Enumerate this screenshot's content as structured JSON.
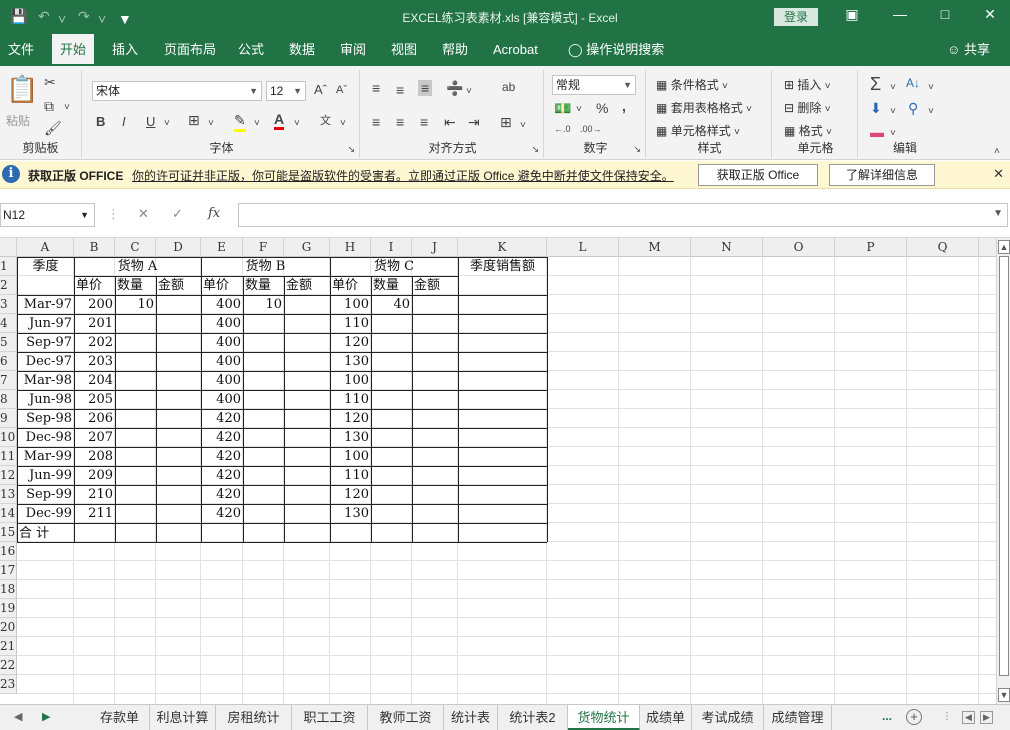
{
  "window": {
    "title": "EXCEL练习表素材.xls  [兼容模式]  -  Excel",
    "login_label": "登录"
  },
  "ribbon_tabs": [
    "文件",
    "开始",
    "插入",
    "页面布局",
    "公式",
    "数据",
    "审阅",
    "视图",
    "帮助",
    "Acrobat"
  ],
  "active_tab": "开始",
  "tell_me": "操作说明搜索",
  "share_label": "共享",
  "ribbon": {
    "clipboard": {
      "paste": "粘贴",
      "label": "剪贴板"
    },
    "font": {
      "name": "宋体",
      "size": "12",
      "label": "字体",
      "bold": "B",
      "italic": "I",
      "underline": "U"
    },
    "alignment": {
      "label": "对齐方式"
    },
    "number": {
      "format": "常规",
      "label": "数字"
    },
    "styles": {
      "conditional": "条件格式",
      "table": "套用表格格式",
      "cell_styles": "单元格样式",
      "label": "样式"
    },
    "cells": {
      "insert": "插入",
      "delete": "删除",
      "format": "格式",
      "label": "单元格"
    },
    "editing": {
      "label": "编辑"
    }
  },
  "infobar": {
    "title": "获取正版 OFFICE",
    "message": "你的许可证并非正版，你可能是盗版软件的受害者。立即通过正版 Office 避免中断并使文件保持安全。",
    "button_get": "获取正版 Office",
    "button_learn": "了解详细信息"
  },
  "formula_bar": {
    "name_box": "N12",
    "formula": ""
  },
  "columns": [
    "A",
    "B",
    "C",
    "D",
    "E",
    "F",
    "G",
    "H",
    "I",
    "J",
    "K",
    "L",
    "M",
    "N",
    "O",
    "P",
    "Q"
  ],
  "rows": [
    "1",
    "2",
    "3",
    "4",
    "5",
    "6",
    "7",
    "8",
    "9",
    "10",
    "11",
    "12",
    "13",
    "14",
    "15",
    "16",
    "17",
    "18",
    "19",
    "20",
    "21",
    "22",
    "23"
  ],
  "sheet": {
    "header1": {
      "season": "季度",
      "goods_a": "货物 A",
      "goods_b": "货物 B",
      "goods_c": "货物 C",
      "total_sales": "季度销售额"
    },
    "header2": [
      "单价",
      "数量",
      "金额",
      "单价",
      "数量",
      "金额",
      "单价",
      "数量",
      "金额"
    ],
    "data": [
      {
        "q": "Mar-97",
        "pa": "200",
        "na": "10",
        "pb": "400",
        "nb": "10",
        "pc": "100",
        "nc": "40"
      },
      {
        "q": "Jun-97",
        "pa": "201",
        "na": "",
        "pb": "400",
        "nb": "",
        "pc": "110",
        "nc": ""
      },
      {
        "q": "Sep-97",
        "pa": "202",
        "na": "",
        "pb": "400",
        "nb": "",
        "pc": "120",
        "nc": ""
      },
      {
        "q": "Dec-97",
        "pa": "203",
        "na": "",
        "pb": "400",
        "nb": "",
        "pc": "130",
        "nc": ""
      },
      {
        "q": "Mar-98",
        "pa": "204",
        "na": "",
        "pb": "400",
        "nb": "",
        "pc": "100",
        "nc": ""
      },
      {
        "q": "Jun-98",
        "pa": "205",
        "na": "",
        "pb": "400",
        "nb": "",
        "pc": "110",
        "nc": ""
      },
      {
        "q": "Sep-98",
        "pa": "206",
        "na": "",
        "pb": "420",
        "nb": "",
        "pc": "120",
        "nc": ""
      },
      {
        "q": "Dec-98",
        "pa": "207",
        "na": "",
        "pb": "420",
        "nb": "",
        "pc": "130",
        "nc": ""
      },
      {
        "q": "Mar-99",
        "pa": "208",
        "na": "",
        "pb": "420",
        "nb": "",
        "pc": "100",
        "nc": ""
      },
      {
        "q": "Jun-99",
        "pa": "209",
        "na": "",
        "pb": "420",
        "nb": "",
        "pc": "110",
        "nc": ""
      },
      {
        "q": "Sep-99",
        "pa": "210",
        "na": "",
        "pb": "420",
        "nb": "",
        "pc": "120",
        "nc": ""
      },
      {
        "q": "Dec-99",
        "pa": "211",
        "na": "",
        "pb": "420",
        "nb": "",
        "pc": "130",
        "nc": ""
      }
    ],
    "total_label": "合  计"
  },
  "sheet_tabs": [
    "存款单",
    "利息计算",
    "房租统计",
    "职工工资",
    "教师工资",
    "统计表",
    "统计表2",
    "货物统计",
    "成绩单",
    "考试成绩",
    "成绩管理"
  ],
  "active_sheet": "货物统计",
  "colors": {
    "excel_green": "#217346",
    "infobar_bg": "#fff7d1"
  }
}
